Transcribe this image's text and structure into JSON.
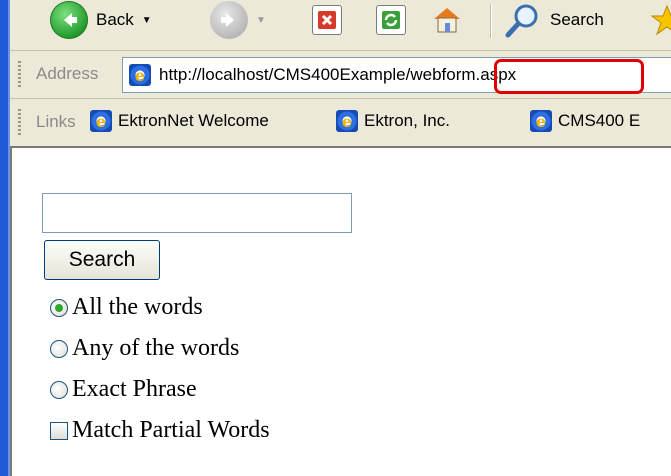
{
  "toolbar": {
    "back_label": "Back",
    "search_label": "Search"
  },
  "address": {
    "label": "Address",
    "url_prefix": "http://localhost/CMS400Example",
    "url_suffix": "/webform.aspx"
  },
  "links": {
    "label": "Links",
    "items": [
      {
        "label": "EktronNet  Welcome"
      },
      {
        "label": "Ektron, Inc."
      },
      {
        "label": "CMS400 E"
      }
    ]
  },
  "form": {
    "search_input_value": "",
    "search_button_label": "Search",
    "options": [
      {
        "label": "All the words",
        "type": "radio",
        "checked": true
      },
      {
        "label": "Any of the words",
        "type": "radio",
        "checked": false
      },
      {
        "label": "Exact Phrase",
        "type": "radio",
        "checked": false
      },
      {
        "label": "Match Partial Words",
        "type": "checkbox",
        "checked": false
      }
    ]
  },
  "colors": {
    "highlight": "#e00000",
    "radio_selected": "#2fa72f"
  }
}
